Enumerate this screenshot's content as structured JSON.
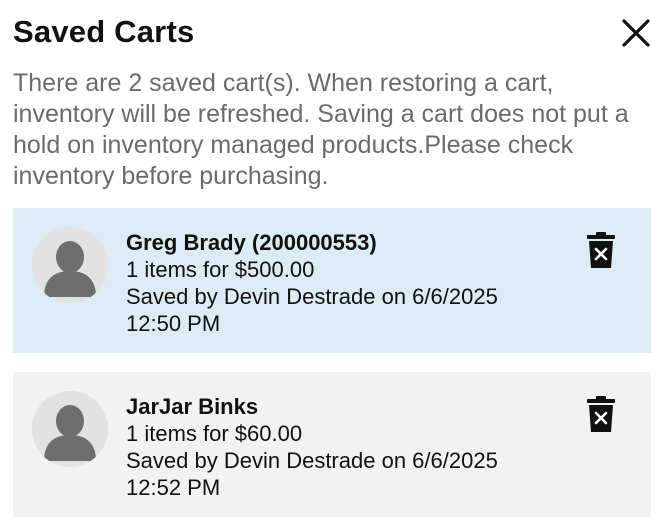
{
  "header": {
    "title": "Saved Carts",
    "close_icon": "close-icon"
  },
  "info_text": "There are 2 saved cart(s). When restoring a cart, inventory will be refreshed. Saving a cart does not put a hold on inventory managed products.Please check inventory before purchasing.",
  "carts": [
    {
      "name": "Greg Brady (200000553)",
      "items_line": "1 items for $500.00",
      "saved_line": "Saved by Devin Destrade on 6/6/2025",
      "time_line": "12:50 PM",
      "selected": true,
      "avatar_icon": "user-silhouette-icon",
      "delete_icon": "trash-delete-icon"
    },
    {
      "name": "JarJar Binks",
      "items_line": "1 items for $60.00",
      "saved_line": "Saved by Devin Destrade on 6/6/2025",
      "time_line": "12:52 PM",
      "selected": false,
      "avatar_icon": "user-silhouette-icon",
      "delete_icon": "trash-delete-icon"
    }
  ],
  "colors": {
    "selected_background": "#dcebf4",
    "card_background": "#f2f2f2",
    "info_text": "#6b6b6b",
    "avatar_background": "#e2e2e2",
    "avatar_silhouette": "#6e6e6e"
  }
}
